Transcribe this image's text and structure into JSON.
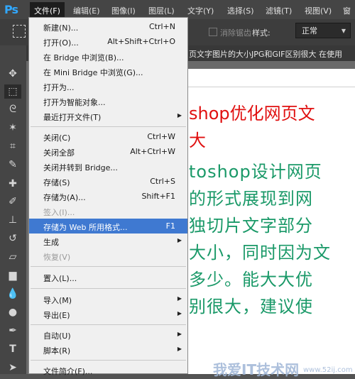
{
  "app": {
    "logo": "Ps"
  },
  "menubar": {
    "items": [
      "文件(F)",
      "编辑(E)",
      "图像(I)",
      "图层(L)",
      "文字(Y)",
      "选择(S)",
      "滤镜(T)",
      "视图(V)"
    ]
  },
  "options_bar": {
    "antialias_label": "消除锯齿",
    "style_label": "样式:",
    "style_value": "正常"
  },
  "document": {
    "tab_title": "页文字图片的大小JPG和GIF区别很大 在使用",
    "lines_red": [
      "shop优化网页文",
      "大"
    ],
    "lines_green": [
      "toshop设计网页",
      "的形式展现到网",
      "独切片文字部分",
      "大小，同时因为文",
      "多少。能大大优",
      "别很大，建议使"
    ]
  },
  "file_menu": {
    "items": [
      {
        "label": "新建(N)...",
        "shortcut": "Ctrl+N"
      },
      {
        "label": "打开(O)...",
        "shortcut": "Alt+Shift+Ctrl+O"
      },
      {
        "label": "在 Bridge 中浏览(B)...",
        "shortcut": ""
      },
      {
        "label": "在 Mini Bridge 中浏览(G)...",
        "shortcut": ""
      },
      {
        "label": "打开为...",
        "shortcut": ""
      },
      {
        "label": "打开为智能对象...",
        "shortcut": ""
      },
      {
        "label": "最近打开文件(T)",
        "shortcut": ""
      },
      {
        "label": "关闭(C)",
        "shortcut": "Ctrl+W"
      },
      {
        "label": "关闭全部",
        "shortcut": "Alt+Ctrl+W"
      },
      {
        "label": "关闭并转到 Bridge...",
        "shortcut": ""
      },
      {
        "label": "存储(S)",
        "shortcut": "Ctrl+S"
      },
      {
        "label": "存储为(A)...",
        "shortcut": "Shift+F1"
      },
      {
        "label": "签入(I)...",
        "shortcut": ""
      },
      {
        "label": "存储为 Web 所用格式...",
        "shortcut": "F1"
      },
      {
        "label": "生成",
        "shortcut": ""
      },
      {
        "label": "恢复(V)",
        "shortcut": ""
      },
      {
        "label": "置入(L)...",
        "shortcut": ""
      },
      {
        "label": "导入(M)",
        "shortcut": ""
      },
      {
        "label": "导出(E)",
        "shortcut": ""
      },
      {
        "label": "自动(U)",
        "shortcut": ""
      },
      {
        "label": "脚本(R)",
        "shortcut": ""
      },
      {
        "label": "文件简介(F)...",
        "shortcut": ""
      }
    ]
  },
  "watermark": {
    "text": "我爱IT技术网",
    "url": "www.52ij.com"
  },
  "colors": {
    "highlight": "#3f79d1",
    "red_text": "#e01010",
    "green_text": "#1a9968"
  }
}
